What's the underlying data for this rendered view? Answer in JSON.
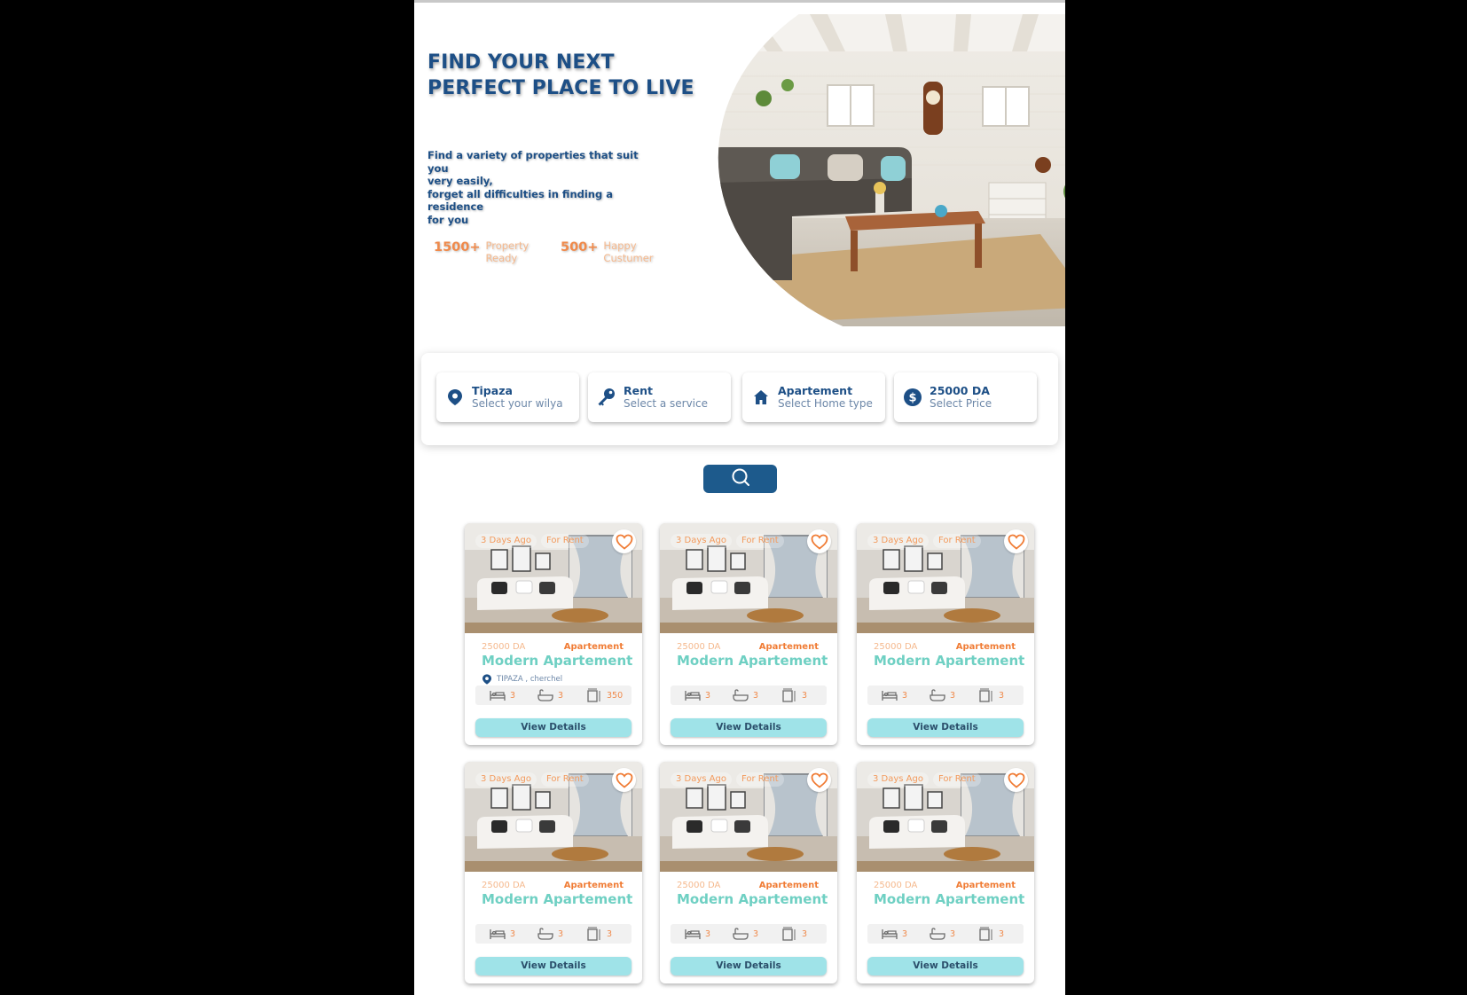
{
  "hero": {
    "title": "FIND YOUR NEXT PERFECT PLACE TO LIVE",
    "subtitle_lines": [
      "Find a variety of properties that suit you",
      "very easily,",
      "forget all difficulties in finding a residence",
      "for you"
    ],
    "stats": [
      {
        "value": "1500+",
        "label": "Property Ready"
      },
      {
        "value": "500+",
        "label": "Happy Custumer"
      }
    ]
  },
  "search": {
    "filters": [
      {
        "icon": "location-pin-icon",
        "title": "Tipaza",
        "hint": "Select your wilya"
      },
      {
        "icon": "key-icon",
        "title": "Rent",
        "hint": "Select a service"
      },
      {
        "icon": "home-icon",
        "title": "Apartement",
        "hint": "Select Home type"
      },
      {
        "icon": "dollar-icon",
        "title": "25000 DA",
        "hint": "Select Price"
      }
    ],
    "button_icon": "search-icon"
  },
  "listings": [
    {
      "age": "3 Days Ago",
      "status": "For Rent",
      "price": "25000 DA",
      "type": "Apartement",
      "name": "Modern Apartement",
      "location": "TIPAZA , cherchel",
      "beds": "3",
      "baths": "3",
      "area": "350",
      "cta": "View Details"
    },
    {
      "age": "3 Days Ago",
      "status": "For Rent",
      "price": "25000 DA",
      "type": "Apartement",
      "name": "Modern Apartement",
      "location": "",
      "beds": "3",
      "baths": "3",
      "area": "3",
      "cta": "View Details"
    },
    {
      "age": "3 Days Ago",
      "status": "For Rent",
      "price": "25000 DA",
      "type": "Apartement",
      "name": "Modern Apartement",
      "location": "",
      "beds": "3",
      "baths": "3",
      "area": "3",
      "cta": "View Details"
    },
    {
      "age": "3 Days Ago",
      "status": "For Rent",
      "price": "25000 DA",
      "type": "Apartement",
      "name": "Modern Apartement",
      "location": "",
      "beds": "3",
      "baths": "3",
      "area": "3",
      "cta": "View Details"
    },
    {
      "age": "3 Days Ago",
      "status": "For Rent",
      "price": "25000 DA",
      "type": "Apartement",
      "name": "Modern Apartement",
      "location": "",
      "beds": "3",
      "baths": "3",
      "area": "3",
      "cta": "View Details"
    },
    {
      "age": "3 Days Ago",
      "status": "For Rent",
      "price": "25000 DA",
      "type": "Apartement",
      "name": "Modern Apartement",
      "location": "",
      "beds": "3",
      "baths": "3",
      "area": "3",
      "cta": "View Details"
    }
  ],
  "colors": {
    "brand_blue": "#1d4f86",
    "accent_orange": "#f08a4b",
    "teal": "#6fd0c3",
    "button_cyan": "#9fe3e8"
  }
}
